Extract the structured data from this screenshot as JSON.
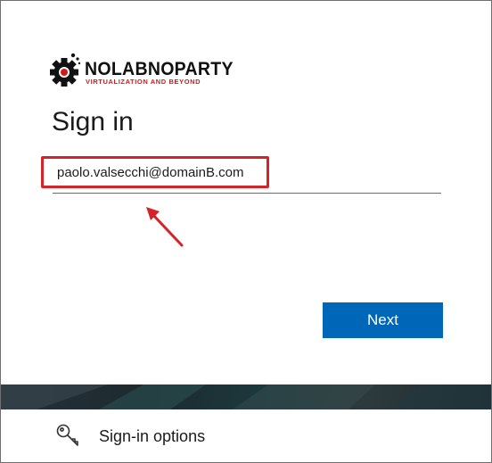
{
  "brand": {
    "logo_name": "NOLABNOPARTY",
    "logo_tagline": "VIRTUALIZATION AND BEYOND",
    "logo_icon": "gear-icon",
    "tagline_color": "#d4191b"
  },
  "signin": {
    "title": "Sign in",
    "email_value": "paolo.valsecchi@domainB.com",
    "next_label": "Next",
    "accent_color": "#0067b8",
    "highlight_color": "#d5232a"
  },
  "options": {
    "label": "Sign-in options",
    "icon": "key-icon"
  }
}
